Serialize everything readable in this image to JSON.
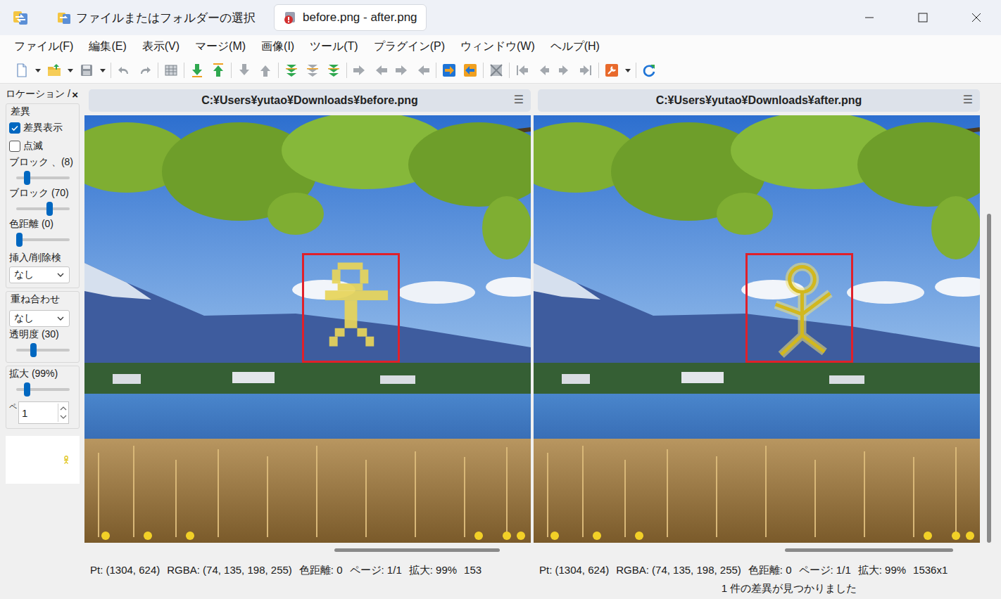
{
  "window": {
    "tabs": [
      {
        "label": "ファイルまたはフォルダーの選択",
        "selected": false
      },
      {
        "label": "before.png - after.png",
        "selected": true
      }
    ]
  },
  "menu": [
    "ファイル(F)",
    "編集(E)",
    "表示(V)",
    "マージ(M)",
    "画像(I)",
    "ツール(T)",
    "プラグイン(P)",
    "ウィンドウ(W)",
    "ヘルプ(H)"
  ],
  "location_pane": {
    "title": "ロケーション /",
    "close": "×",
    "groups": [
      {
        "title": "差異",
        "items": [
          {
            "kind": "checkbox",
            "label": "差異表示",
            "checked": true
          },
          {
            "kind": "checkbox",
            "label": "点滅",
            "checked": false
          },
          {
            "kind": "slider",
            "label": "ブロック 、(8)",
            "level": 0.17
          },
          {
            "kind": "slider",
            "label": "ブロック (70)",
            "level": 0.65
          },
          {
            "kind": "slider",
            "label": "色距離 (0)",
            "level": 0.0
          },
          {
            "kind": "select",
            "label": "挿入/削除検",
            "value": "なし"
          }
        ]
      },
      {
        "title": "重ね合わせ",
        "items": [
          {
            "kind": "select",
            "label": "",
            "value": "なし"
          },
          {
            "kind": "slider",
            "label": "透明度 (30)",
            "level": 0.3
          }
        ]
      },
      {
        "title": "",
        "items": [
          {
            "kind": "slider",
            "label": "拡大 (99%)",
            "level": 0.17
          },
          {
            "kind": "spin",
            "label": "ペ",
            "value": "1"
          }
        ]
      }
    ]
  },
  "panes": [
    {
      "path": "C:¥Users¥yutao¥Downloads¥before.png",
      "menu": "☰",
      "hscroll": {
        "offset": 0.56,
        "size": 0.37
      },
      "diff_style": "pixel",
      "status": [
        "Pt: (1304, 624)",
        "RGBA: (74, 135, 198, 255)",
        "色距離: 0",
        "ページ: 1/1",
        "拡大: 99%",
        "153"
      ]
    },
    {
      "path": "C:¥Users¥yutao¥Downloads¥after.png",
      "menu": "☰",
      "hscroll": {
        "offset": 0.54,
        "size": 0.36
      },
      "vscroll": {
        "offset": 0.23,
        "size": 0.77
      },
      "diff_style": "smooth",
      "status": [
        "Pt: (1304, 624)",
        "RGBA: (74, 135, 198, 255)",
        "色距離: 0",
        "ページ: 1/1",
        "拡大: 99%",
        "1536x1"
      ]
    }
  ],
  "status_bar": {
    "message": "1 件の差異が見つかりました"
  }
}
